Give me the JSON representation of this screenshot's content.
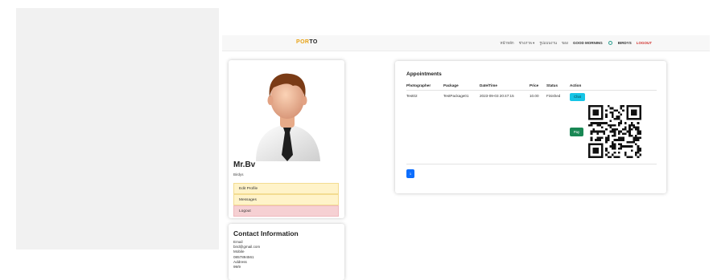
{
  "header": {
    "logo_part1": "POR",
    "logo_part2": "TO",
    "nav": [
      "หน้าหลัก",
      "ช่างภาพ ▾",
      "รูปแบบงาน",
      "ของ"
    ],
    "greeting": "GOOD MORNING",
    "user_label": "BIRDYS",
    "logout": "LOGOUT"
  },
  "profile": {
    "name": "Mr.Bv",
    "username": "Birdys",
    "menu": [
      "Edit Profile",
      "Messages",
      "Logout"
    ]
  },
  "contact": {
    "title": "Contact Information",
    "email_label": "Email",
    "email": "bird@gmail.com",
    "mobile_label": "Mobile",
    "mobile": "0857894561",
    "address_label": "Address",
    "address": "99/9"
  },
  "appointments": {
    "title": "Appointments",
    "headers": [
      "Photographer",
      "Package",
      "Date/Time",
      "Price",
      "Status",
      "Action"
    ],
    "rows": [
      {
        "photographer": "Test02",
        "package": "TestPackage01",
        "datetime": "2023-09-03 20:47:15",
        "price": "10.00",
        "status": "Finished"
      }
    ],
    "chat_label": "Chat",
    "pay_label": "Pay",
    "page": "1"
  },
  "colors": {
    "accent": "#e8a317",
    "chat": "#16c5e6",
    "pay": "#198754",
    "pagination": "#0d6efd"
  }
}
